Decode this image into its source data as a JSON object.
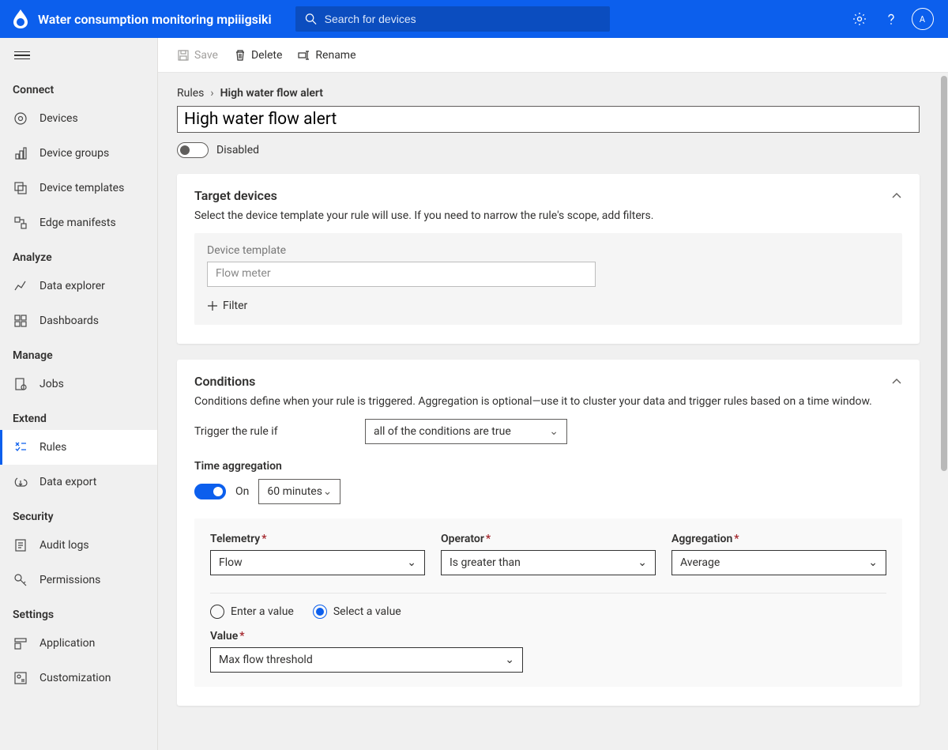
{
  "colors": {
    "primary": "#0c5fed",
    "header_search_bg": "#0b4dbf"
  },
  "header": {
    "app_title": "Water consumption monitoring mpiiigsiki",
    "search_placeholder": "Search for devices",
    "avatar_initials": "A"
  },
  "sidebar": {
    "sections": [
      {
        "label": "Connect",
        "items": [
          {
            "key": "devices",
            "label": "Devices"
          },
          {
            "key": "device-groups",
            "label": "Device groups"
          },
          {
            "key": "device-templates",
            "label": "Device templates"
          },
          {
            "key": "edge-manifests",
            "label": "Edge manifests"
          }
        ]
      },
      {
        "label": "Analyze",
        "items": [
          {
            "key": "data-explorer",
            "label": "Data explorer"
          },
          {
            "key": "dashboards",
            "label": "Dashboards"
          }
        ]
      },
      {
        "label": "Manage",
        "items": [
          {
            "key": "jobs",
            "label": "Jobs"
          }
        ]
      },
      {
        "label": "Extend",
        "items": [
          {
            "key": "rules",
            "label": "Rules",
            "active": true
          },
          {
            "key": "data-export",
            "label": "Data export"
          }
        ]
      },
      {
        "label": "Security",
        "items": [
          {
            "key": "audit-logs",
            "label": "Audit logs"
          },
          {
            "key": "permissions",
            "label": "Permissions"
          }
        ]
      },
      {
        "label": "Settings",
        "items": [
          {
            "key": "application",
            "label": "Application"
          },
          {
            "key": "customization",
            "label": "Customization"
          }
        ]
      }
    ]
  },
  "cmdbar": {
    "save": "Save",
    "delete": "Delete",
    "rename": "Rename"
  },
  "breadcrumb": {
    "root": "Rules",
    "current": "High water flow alert"
  },
  "rule": {
    "name": "High water flow alert",
    "enabled_label": "Disabled",
    "enabled": false
  },
  "target_devices": {
    "title": "Target devices",
    "desc": "Select the device template your rule will use. If you need to narrow the rule's scope, add filters.",
    "device_template_label": "Device template",
    "device_template_value": "Flow meter",
    "filter_btn": "Filter"
  },
  "conditions": {
    "title": "Conditions",
    "desc": "Conditions define when your rule is triggered. Aggregation is optional—use it to cluster your data and trigger rules based on a time window.",
    "trigger_label": "Trigger the rule if",
    "trigger_value": "all of the conditions are true",
    "time_agg_label": "Time aggregation",
    "time_agg_on_label": "On",
    "time_agg_on": true,
    "time_window_value": "60 minutes",
    "cols": {
      "telemetry_label": "Telemetry",
      "operator_label": "Operator",
      "aggregation_label": "Aggregation",
      "telemetry_value": "Flow",
      "operator_value": "Is greater than",
      "aggregation_value": "Average"
    },
    "value_mode": {
      "enter_label": "Enter a value",
      "select_label": "Select a value",
      "selected": "select"
    },
    "value_label": "Value",
    "value_value": "Max flow threshold"
  }
}
